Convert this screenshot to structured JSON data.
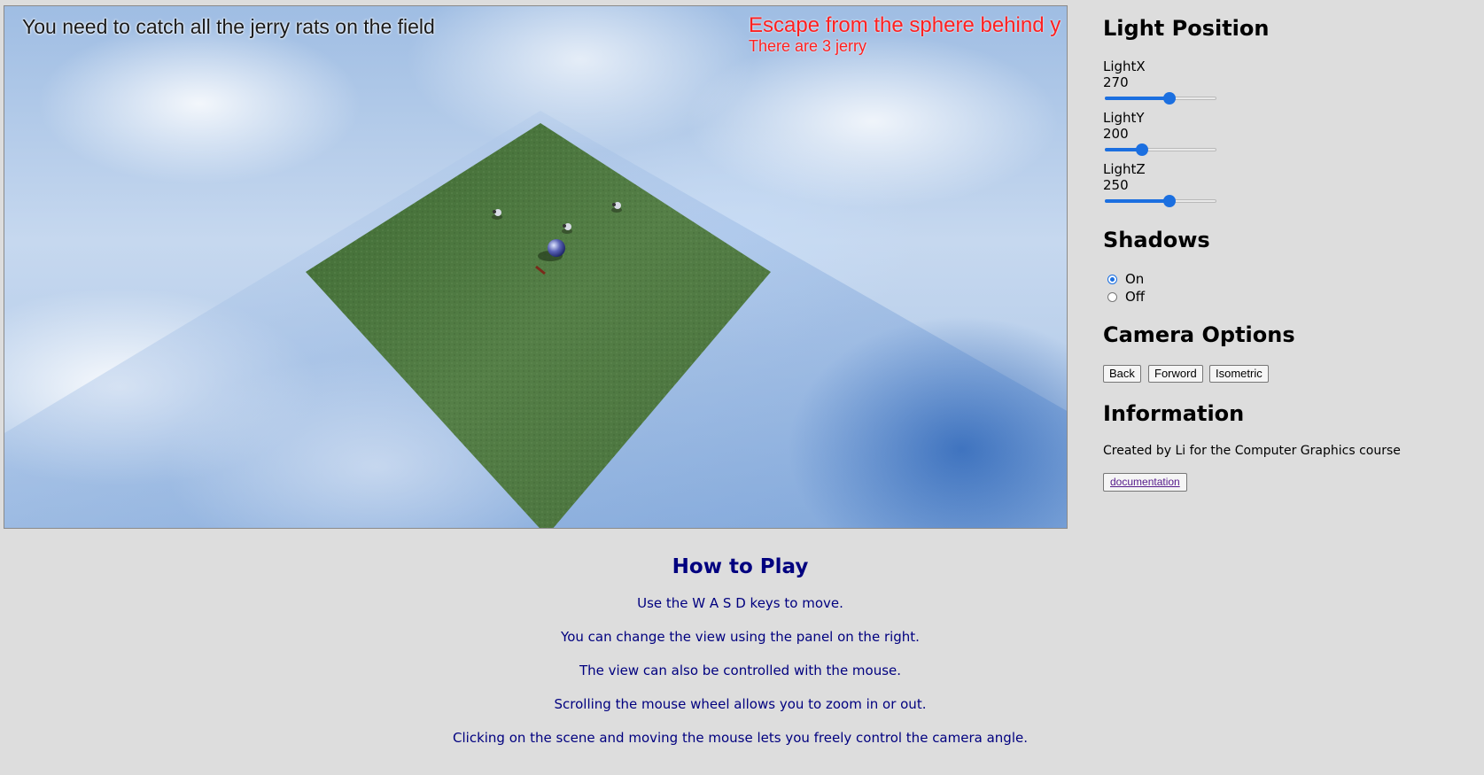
{
  "hud": {
    "objective": "You need to catch all the jerry rats on the field",
    "warning": "Escape from the sphere behind y",
    "count": "There are 3 jerry"
  },
  "panel": {
    "light_heading": "Light Position",
    "sliders": [
      {
        "label": "LightX",
        "value": "270",
        "fraction": 0.59
      },
      {
        "label": "LightY",
        "value": "200",
        "fraction": 0.31
      },
      {
        "label": "LightZ",
        "value": "250",
        "fraction": 0.59
      }
    ],
    "shadows_heading": "Shadows",
    "shadow_options": [
      {
        "label": "On",
        "checked": true
      },
      {
        "label": "Off",
        "checked": false
      }
    ],
    "camera_heading": "Camera Options",
    "camera_buttons": [
      "Back",
      "Forword",
      "Isometric"
    ],
    "info_heading": "Information",
    "info_text": "Created by Li for the Computer Graphics course",
    "doc_link": "documentation"
  },
  "howto": {
    "title": "How to Play",
    "lines": [
      "Use the W A S D keys to move.",
      "You can change the view using the panel on the right.",
      "The view can also be controlled with the mouse.",
      "Scrolling the mouse wheel allows you to zoom in or out.",
      "Clicking on the scene and moving the mouse lets you freely control the camera angle."
    ]
  },
  "colors": {
    "accent": "#1b6fe0",
    "hud_warning": "#ff2020",
    "howto_text": "#00007f",
    "grass": "#4a7a3c"
  },
  "scene_objects": [
    "grass-field",
    "player-sphere",
    "jerry-rat",
    "jerry-rat",
    "jerry-rat",
    "shadow-glass-plane"
  ]
}
